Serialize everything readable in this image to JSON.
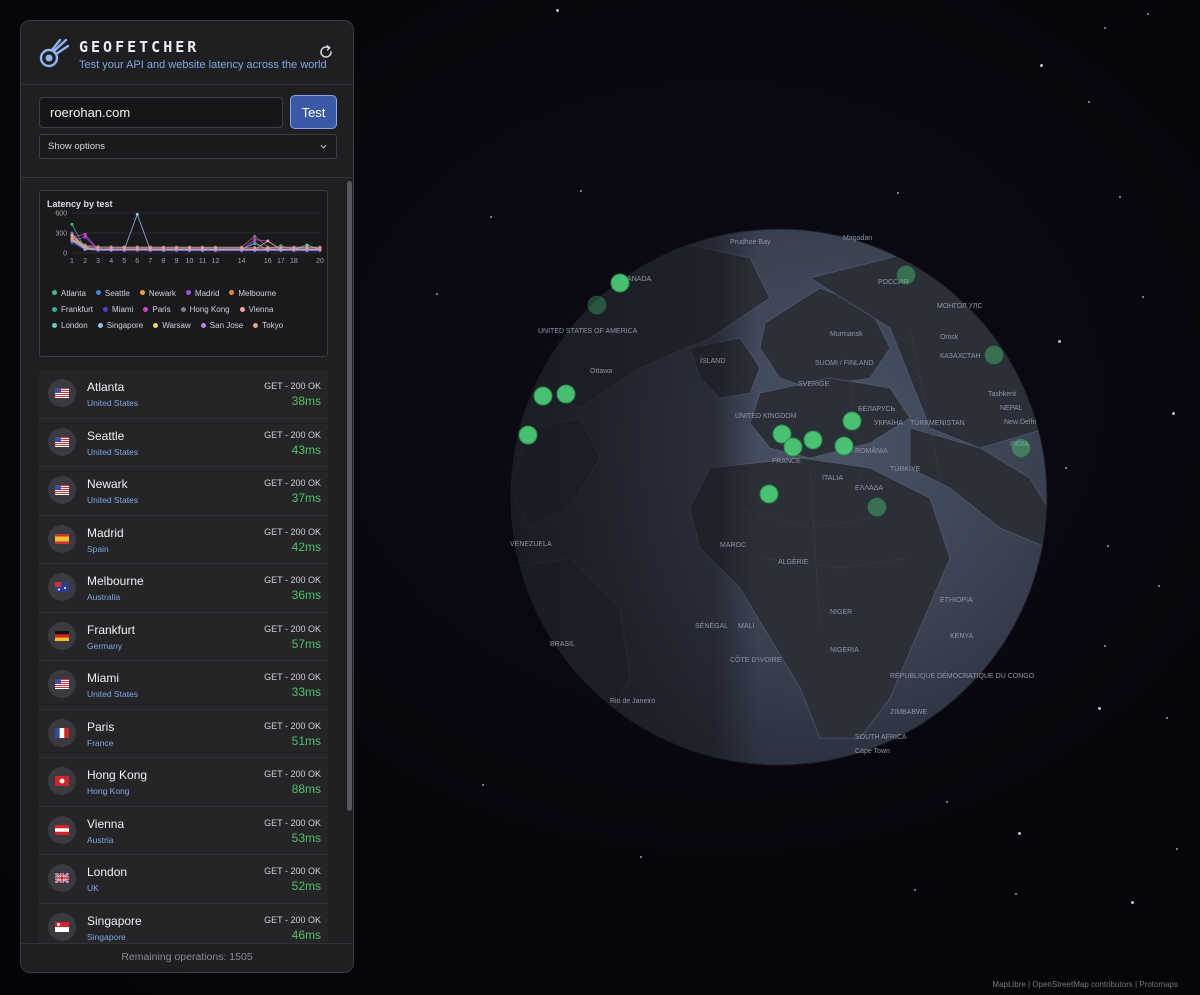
{
  "app": {
    "name": "GEOFETCHER",
    "tagline": "Test your API and website latency across the world",
    "icons": {
      "logo": "comet-icon",
      "refresh": "refresh-icon"
    }
  },
  "form": {
    "url_value": "roerohan.com",
    "test_label": "Test",
    "options_label": "Show options"
  },
  "chart_data": {
    "type": "line",
    "title": "Latency by test",
    "x": [
      1,
      2,
      3,
      4,
      5,
      6,
      7,
      8,
      9,
      10,
      11,
      12,
      14,
      15,
      16,
      17,
      18,
      19,
      20
    ],
    "x_tick_labels": [
      "1",
      "2",
      "3",
      "4",
      "5",
      "6",
      "7",
      "8",
      "9",
      "10",
      "11",
      "12",
      "14",
      "16",
      "17",
      "18",
      "20"
    ],
    "y_ticks": [
      0,
      300,
      600
    ],
    "ylim": [
      0,
      600
    ],
    "grid": true,
    "legend_position": "bottom",
    "series": [
      {
        "name": "Atlanta",
        "color": "#3fbf7f",
        "values": [
          430,
          60,
          45,
          42,
          44,
          48,
          44,
          42,
          45,
          44,
          43,
          44,
          45,
          44,
          46,
          44,
          43,
          42,
          40
        ]
      },
      {
        "name": "Seattle",
        "color": "#4a7fe0",
        "values": [
          300,
          70,
          50,
          48,
          45,
          46,
          44,
          45,
          44,
          46,
          45,
          44,
          45,
          46,
          44,
          45,
          44,
          45,
          43
        ]
      },
      {
        "name": "Newark",
        "color": "#f0a040",
        "values": [
          260,
          55,
          42,
          40,
          42,
          40,
          41,
          40,
          39,
          40,
          41,
          40,
          40,
          41,
          40,
          39,
          40,
          38,
          37
        ]
      },
      {
        "name": "Madrid",
        "color": "#a050e0",
        "values": [
          180,
          240,
          48,
          46,
          45,
          47,
          44,
          45,
          46,
          44,
          45,
          44,
          46,
          160,
          45,
          44,
          46,
          44,
          42
        ]
      },
      {
        "name": "Melbourne",
        "color": "#f08040",
        "values": [
          220,
          90,
          40,
          38,
          40,
          39,
          38,
          39,
          38,
          37,
          38,
          38,
          37,
          38,
          37,
          38,
          37,
          36,
          36
        ]
      },
      {
        "name": "Frankfurt",
        "color": "#30b090",
        "values": [
          200,
          80,
          60,
          58,
          59,
          60,
          58,
          59,
          58,
          57,
          58,
          59,
          58,
          140,
          58,
          110,
          58,
          57,
          57
        ]
      },
      {
        "name": "Miami",
        "color": "#5040c0",
        "values": [
          150,
          50,
          36,
          35,
          34,
          35,
          34,
          35,
          34,
          33,
          34,
          33,
          34,
          33,
          34,
          33,
          34,
          33,
          33
        ]
      },
      {
        "name": "Paris",
        "color": "#d040d0",
        "values": [
          240,
          280,
          55,
          52,
          53,
          54,
          52,
          53,
          52,
          51,
          52,
          51,
          52,
          200,
          180,
          52,
          51,
          52,
          51
        ]
      },
      {
        "name": "Hong Kong",
        "color": "#808088",
        "values": [
          250,
          120,
          95,
          92,
          90,
          91,
          90,
          89,
          90,
          88,
          89,
          88,
          89,
          250,
          90,
          89,
          88,
          89,
          88
        ]
      },
      {
        "name": "Vienna",
        "color": "#f0a0a0",
        "values": [
          260,
          70,
          56,
          55,
          54,
          55,
          54,
          55,
          54,
          53,
          54,
          53,
          54,
          53,
          180,
          54,
          53,
          54,
          53
        ]
      },
      {
        "name": "London",
        "color": "#60d0b0",
        "values": [
          180,
          60,
          54,
          53,
          54,
          53,
          54,
          53,
          52,
          53,
          52,
          53,
          52,
          53,
          52,
          53,
          52,
          120,
          52
        ]
      },
      {
        "name": "Singapore",
        "color": "#90c0f0",
        "values": [
          200,
          90,
          50,
          48,
          49,
          580,
          48,
          47,
          48,
          47,
          46,
          47,
          46,
          47,
          46,
          47,
          46,
          47,
          46
        ]
      },
      {
        "name": "Warsaw",
        "color": "#f0d060",
        "values": [
          210,
          65,
          58,
          56,
          57,
          56,
          55,
          56,
          55,
          56,
          55,
          56,
          55,
          56,
          55,
          56,
          55,
          56,
          55
        ]
      },
      {
        "name": "San Jose",
        "color": "#c080f0",
        "values": [
          190,
          75,
          60,
          58,
          59,
          58,
          57,
          58,
          57,
          58,
          57,
          58,
          57,
          58,
          57,
          58,
          57,
          58,
          57
        ]
      },
      {
        "name": "Tokyo",
        "color": "#f0a080",
        "values": [
          270,
          100,
          80,
          78,
          79,
          78,
          77,
          78,
          77,
          78,
          77,
          78,
          77,
          78,
          77,
          78,
          77,
          78,
          77
        ]
      }
    ]
  },
  "results": [
    {
      "city": "Atlanta",
      "country": "United States",
      "flag": "us",
      "status": "GET - 200 OK",
      "latency": "38ms"
    },
    {
      "city": "Seattle",
      "country": "United States",
      "flag": "us",
      "status": "GET - 200 OK",
      "latency": "43ms"
    },
    {
      "city": "Newark",
      "country": "United States",
      "flag": "us",
      "status": "GET - 200 OK",
      "latency": "37ms"
    },
    {
      "city": "Madrid",
      "country": "Spain",
      "flag": "es",
      "status": "GET - 200 OK",
      "latency": "42ms"
    },
    {
      "city": "Melbourne",
      "country": "Australia",
      "flag": "au",
      "status": "GET - 200 OK",
      "latency": "36ms"
    },
    {
      "city": "Frankfurt",
      "country": "Germany",
      "flag": "de",
      "status": "GET - 200 OK",
      "latency": "57ms"
    },
    {
      "city": "Miami",
      "country": "United States",
      "flag": "us",
      "status": "GET - 200 OK",
      "latency": "33ms"
    },
    {
      "city": "Paris",
      "country": "France",
      "flag": "fr",
      "status": "GET - 200 OK",
      "latency": "51ms"
    },
    {
      "city": "Hong Kong",
      "country": "Hong Kong",
      "flag": "hk",
      "status": "GET - 200 OK",
      "latency": "88ms"
    },
    {
      "city": "Vienna",
      "country": "Austria",
      "flag": "at",
      "status": "GET - 200 OK",
      "latency": "53ms"
    },
    {
      "city": "London",
      "country": "UK",
      "flag": "gb",
      "status": "GET - 200 OK",
      "latency": "52ms"
    },
    {
      "city": "Singapore",
      "country": "Singapore",
      "flag": "sg",
      "status": "GET - 200 OK",
      "latency": "46ms"
    }
  ],
  "footer": {
    "remaining": "Remaining operations: 1505"
  },
  "map": {
    "attribution": "MapLibre | OpenStreetMap contributors | Protomaps",
    "marker_color": "#4ed07a",
    "labels": [
      "CANADA",
      "UNITED STATES OF AMERICA",
      "Ottawa",
      "ÍSLAND",
      "SUOMI / FINLAND",
      "SVERIGE",
      "Murmansk",
      "UNITED KINGDOM",
      "FRANCE",
      "ITALIA",
      "БЕЛАРУСЬ",
      "УКРАЇНА",
      "ROMÂNIA",
      "TÜRKIYE",
      "ΕΛΛΑΔΑ",
      "РОССИЯ",
      "МОНГОЛ УЛС",
      "КАЗАХСТАН",
      "TÜRKMENISTAN",
      "NEPAL",
      "INDIA",
      "MAROC",
      "ALGÉRIE",
      "NIGER",
      "MALI",
      "SÉNÉGAL",
      "NIGERIA",
      "KENYA",
      "VENEZUELA",
      "BRASIL",
      "Rio de Janeiro",
      "SOUTH AFRICA",
      "Cape Town",
      "ZIMBABWE",
      "RÉPUBLIQUE DÉMOCRATIQUE DU CONGO",
      "CÔTE D'IVOIRE",
      "ETHIOPIA",
      "Magadan",
      "Prudhoe Bay",
      "Tashkent",
      "New Delhi",
      "Omsk"
    ]
  }
}
